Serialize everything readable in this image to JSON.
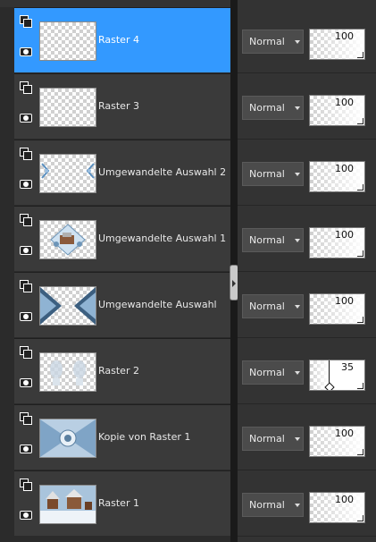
{
  "layers": [
    {
      "name": "Raster 4",
      "selected": true,
      "thumb": "transparent",
      "blend_mode": "Normal",
      "opacity": "100"
    },
    {
      "name": "Raster 3",
      "selected": false,
      "thumb": "transparent",
      "blend_mode": "Normal",
      "opacity": "100"
    },
    {
      "name": "Umgewandelte Auswahl 2",
      "selected": false,
      "thumb": "corner-ornaments",
      "blend_mode": "Normal",
      "opacity": "100"
    },
    {
      "name": "Umgewandelte Auswahl 1",
      "selected": false,
      "thumb": "center-tile",
      "blend_mode": "Normal",
      "opacity": "100"
    },
    {
      "name": "Umgewandelte Auswahl",
      "selected": false,
      "thumb": "side-wedges",
      "blend_mode": "Normal",
      "opacity": "100"
    },
    {
      "name": "Raster 2",
      "selected": false,
      "thumb": "faint-shapes",
      "blend_mode": "Normal",
      "opacity": "35"
    },
    {
      "name": "Kopie von Raster 1",
      "selected": false,
      "thumb": "kaleidoscope",
      "blend_mode": "Normal",
      "opacity": "100"
    },
    {
      "name": "Raster 1",
      "selected": false,
      "thumb": "winter-scene",
      "blend_mode": "Normal",
      "opacity": "100"
    }
  ],
  "icons": {
    "layer_type": "layer-stack-icon",
    "visibility": "eye-icon",
    "dropdown": "chevron-down-icon"
  },
  "colors": {
    "selection": "#3399ff",
    "panel": "#3a3a3a",
    "background": "#2a2a2a"
  }
}
